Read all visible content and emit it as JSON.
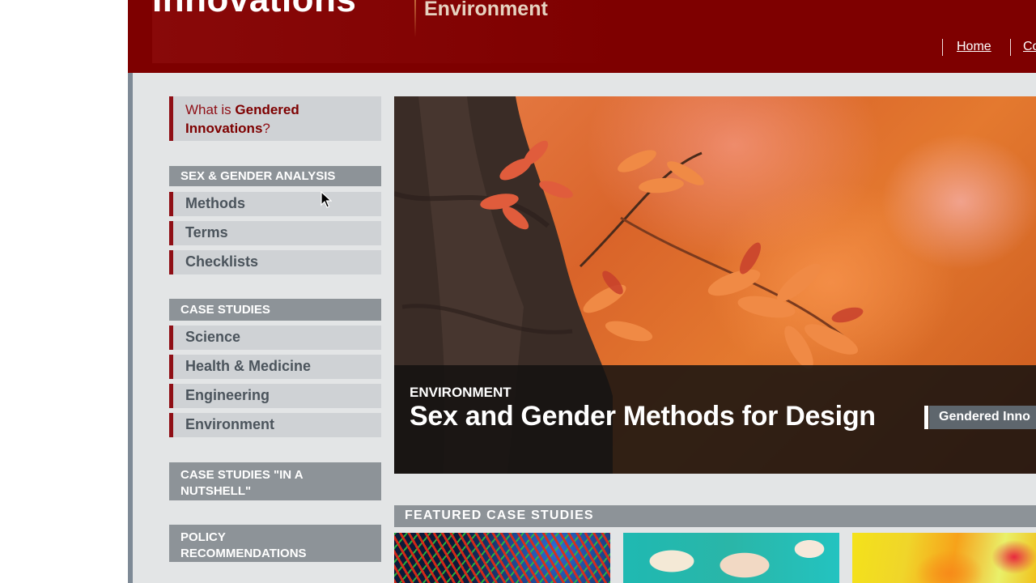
{
  "header": {
    "logo_text": "Innovations",
    "section_title": "Environment",
    "nav": [
      {
        "label": "Home"
      },
      {
        "label": "Co"
      }
    ]
  },
  "sidebar": {
    "intro": {
      "prefix": "What is ",
      "emphasis": "Gendered Innovations",
      "suffix": "?"
    },
    "groups": [
      {
        "heading": "SEX & GENDER ANALYSIS",
        "items": [
          {
            "label": "Methods"
          },
          {
            "label": "Terms"
          },
          {
            "label": "Checklists"
          }
        ]
      },
      {
        "heading": "CASE STUDIES",
        "items": [
          {
            "label": "Science"
          },
          {
            "label": "Health & Medicine"
          },
          {
            "label": "Engineering"
          },
          {
            "label": "Environment"
          }
        ]
      }
    ],
    "links": [
      {
        "label": "CASE STUDIES \"IN A NUTSHELL\""
      },
      {
        "label": "POLICY RECOMMENDATIONS"
      }
    ]
  },
  "hero": {
    "category": "ENVIRONMENT",
    "title": "Sex and Gender Methods for Design",
    "tag": "Gendered Inno"
  },
  "featured": {
    "heading": "FEATURED CASE STUDIES"
  },
  "colors": {
    "brand_red": "#7e0000",
    "accent_red": "#8f0f16",
    "sidebar_bg": "#cfd2d5",
    "header_gray": "#8d9398"
  }
}
